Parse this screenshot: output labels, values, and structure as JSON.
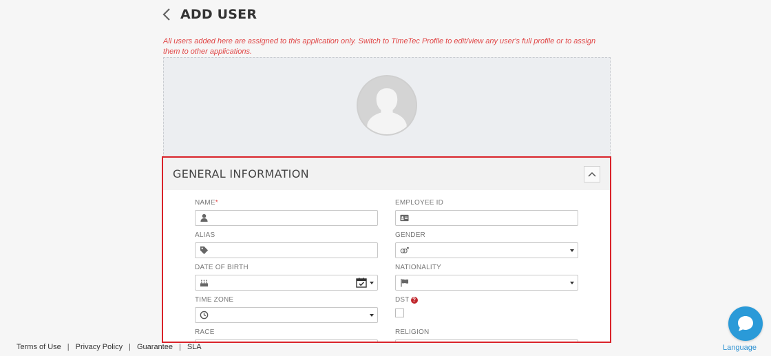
{
  "header": {
    "title": "ADD USER"
  },
  "notice": "All users added here are assigned to this application only. Switch to TimeTec Profile to edit/view any user's full profile or to assign them to other applications.",
  "general_info": {
    "title": "GENERAL INFORMATION",
    "fields": {
      "name": {
        "label": "NAME",
        "required_mark": "*",
        "icon": "user-icon",
        "value": ""
      },
      "employee_id": {
        "label": "EMPLOYEE ID",
        "icon": "id-card-icon",
        "value": ""
      },
      "alias": {
        "label": "ALIAS",
        "icon": "tag-icon",
        "value": ""
      },
      "gender": {
        "label": "GENDER",
        "icon": "gender-icon",
        "selected": ""
      },
      "date_of_birth": {
        "label": "DATE OF BIRTH",
        "icon": "birthday-cake-icon",
        "value": ""
      },
      "nationality": {
        "label": "NATIONALITY",
        "icon": "flag-icon",
        "selected": ""
      },
      "time_zone": {
        "label": "TIME ZONE",
        "icon": "clock-icon",
        "selected": ""
      },
      "dst": {
        "label": "DST",
        "help": "?",
        "checked": false
      },
      "race": {
        "label": "RACE"
      },
      "religion": {
        "label": "RELIGION"
      }
    }
  },
  "footer": {
    "links": [
      "Terms of Use",
      "Privacy Policy",
      "Guarantee",
      "SLA"
    ],
    "separator": "|",
    "language": "Language"
  },
  "colors": {
    "accent_red": "#d9232a",
    "link_blue": "#2a8fd1",
    "chat_blue": "#2a9ad8"
  }
}
